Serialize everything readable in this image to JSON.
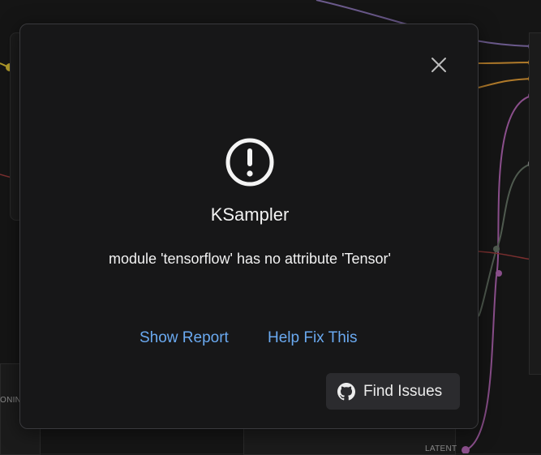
{
  "dialog": {
    "title": "KSampler",
    "message": "module 'tensorflow' has no attribute 'Tensor'",
    "show_report_label": "Show Report",
    "help_fix_label": "Help Fix This",
    "find_issues_label": "Find Issues"
  },
  "background": {
    "left_node_label": "ONIN",
    "latent_label": "LATENT"
  },
  "colors": {
    "link_blue": "#6aa9f0",
    "dialog_bg": "#171718",
    "button_bg": "#2b2b2e"
  },
  "icons": {
    "close": "close-icon",
    "error": "exclamation-circle-icon",
    "github": "github-icon"
  }
}
